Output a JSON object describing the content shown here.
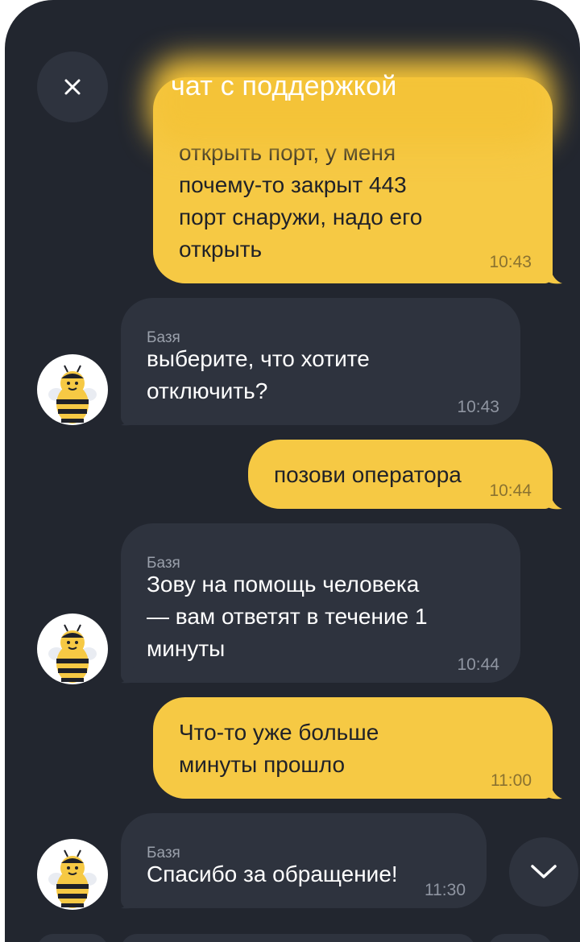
{
  "header": {
    "title": "чат с поддержкой",
    "close_icon": "close-icon"
  },
  "messages": [
    {
      "from": "user",
      "text": "открыть порт, у меня\nпочему-то закрыт 443\nпорт снаружи, надо его\nоткрыть",
      "time": "10:43"
    },
    {
      "from": "bot",
      "sender": "Базя",
      "text": "выберите, что хотите\nотключить?",
      "time": "10:43"
    },
    {
      "from": "user",
      "text": "позови оператора",
      "time": "10:44"
    },
    {
      "from": "bot",
      "sender": "Базя",
      "text": "Зову на помощь человека\n— вам ответят в течение 1\nминуты",
      "time": "10:44"
    },
    {
      "from": "user",
      "text": "Что-то уже больше\nминуты прошло",
      "time": "11:00"
    },
    {
      "from": "bot",
      "sender": "Базя",
      "text": "Спасибо за обращение!",
      "time": "11:30"
    }
  ],
  "avatar_icon": "bee-avatar-icon",
  "scroll_down_icon": "chevron-down-icon",
  "colors": {
    "background": "#22262f",
    "user_bubble": "#f6c944",
    "bot_bubble": "#2e333e",
    "accent": "#f4c338"
  }
}
